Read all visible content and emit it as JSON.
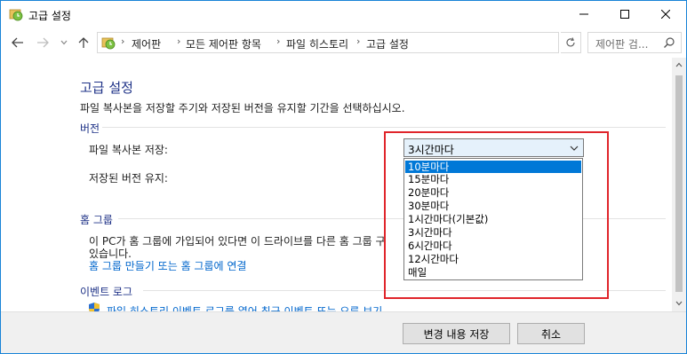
{
  "window": {
    "title": "고급 설정",
    "controls": {
      "minimize": "minimize",
      "maximize": "maximize",
      "close": "close"
    }
  },
  "nav": {
    "breadcrumbs": [
      "제어판",
      "모든 제어판 항목",
      "파일 히스토리",
      "고급 설정"
    ],
    "search_placeholder": "제어판 검..."
  },
  "page": {
    "title": "고급 설정",
    "description": "파일 복사본을 저장할 주기와 저장된 버전을 유지할 기간을 선택하십시오."
  },
  "versions": {
    "header": "버전",
    "save_copies_label": "파일 복사본 저장:",
    "keep_versions_label": "저장된 버전 유지:",
    "save_frequency_selected": "3시간마다",
    "save_frequency_options": [
      "10분마다",
      "15분마다",
      "20분마다",
      "30분마다",
      "1시간마다(기본값)",
      "3시간마다",
      "6시간마다",
      "12시간마다",
      "매일"
    ],
    "highlighted_option": "10분마다"
  },
  "homegroup": {
    "header": "홈 그룹",
    "text_line1": "이 PC가 홈 그룹에 가입되어 있다면 이 드라이브를 다른 홈 그룹 구",
    "text_line2": "있습니다.",
    "link": "홈 그룹 만들기 또는 홈 그룹에 연결"
  },
  "eventlog": {
    "header": "이벤트 로그",
    "link": "파일 히스토리 이벤트 로그를 열어 최근 이벤트 또는 오류 보기"
  },
  "footer": {
    "save_button": "변경 내용 저장",
    "cancel_button": "취소"
  },
  "colors": {
    "accent": "#0078d7",
    "heading": "#1e3287",
    "link": "#0066cc",
    "highlight_box": "#e0252b"
  }
}
